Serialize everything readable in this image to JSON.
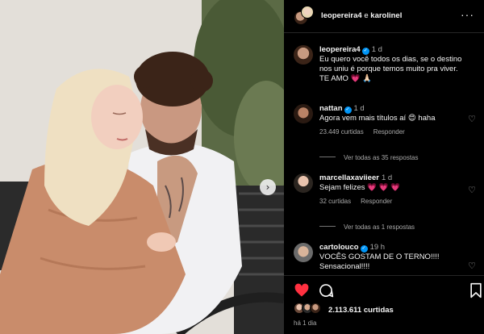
{
  "post": {
    "header": {
      "author": "leopereira4",
      "connector": "e",
      "collaborator": "karolinel"
    },
    "caption": {
      "username": "leopereira4",
      "time": "1 d",
      "text": "Eu quero você todos os dias, se o destino nos uniu é porque temos muito pra viver. TE AMO 💗 🙏🏻"
    },
    "comments": [
      {
        "username": "nattan",
        "time": "1 d",
        "text": "Agora vem mais títulos aí 😍 haha",
        "likes": "23.449 curtidas",
        "reply_label": "Responder",
        "view_replies": "Ver todas as 35 respostas"
      },
      {
        "username": "marcellaxaviieer",
        "time": "1 d",
        "text": "Sejam felizes 💗 💗 💗",
        "likes": "32 curtidas",
        "reply_label": "Responder",
        "view_replies": "Ver todas as 1 respostas"
      },
      {
        "username": "cartolouco",
        "time": "19 h",
        "text": "VOCÊS GOSTAM DE O TERNO!!!! Sensacional!!!!"
      }
    ],
    "likes_count": "2.113.611",
    "likes_word": "curtidas",
    "date": "há 1 dia"
  },
  "icons": {
    "more": "more-options-icon",
    "like": "heart-icon",
    "comment": "comment-icon",
    "save": "bookmark-icon",
    "next": "chevron-right-icon"
  },
  "colors": {
    "background": "#000000",
    "text": "#f5f5f5",
    "secondary": "#a8a8a8",
    "like_red": "#ff3040",
    "verified_blue": "#0095f6"
  }
}
